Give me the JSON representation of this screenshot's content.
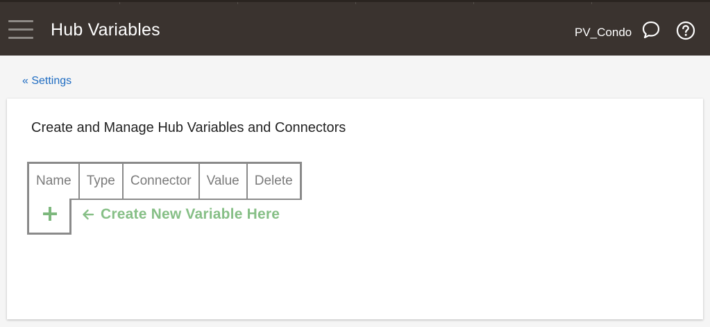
{
  "header": {
    "title": "Hub Variables",
    "hub_name": "PV_Condo",
    "menu_icon": "hamburger-menu-icon",
    "chat_icon": "chat-bubble-icon",
    "help_icon": "help-circle-icon",
    "background_color": "#3a332f"
  },
  "breadcrumb": {
    "label": "« Settings"
  },
  "main": {
    "heading": "Create and Manage Hub Variables and Connectors",
    "table": {
      "columns": [
        "Name",
        "Type",
        "Connector",
        "Value",
        "Delete"
      ],
      "rows": []
    },
    "add_button": {
      "icon": "plus-icon"
    },
    "hint": {
      "icon": "arrow-left-icon",
      "text": "Create New Variable Here",
      "color": "#86bf86"
    }
  }
}
